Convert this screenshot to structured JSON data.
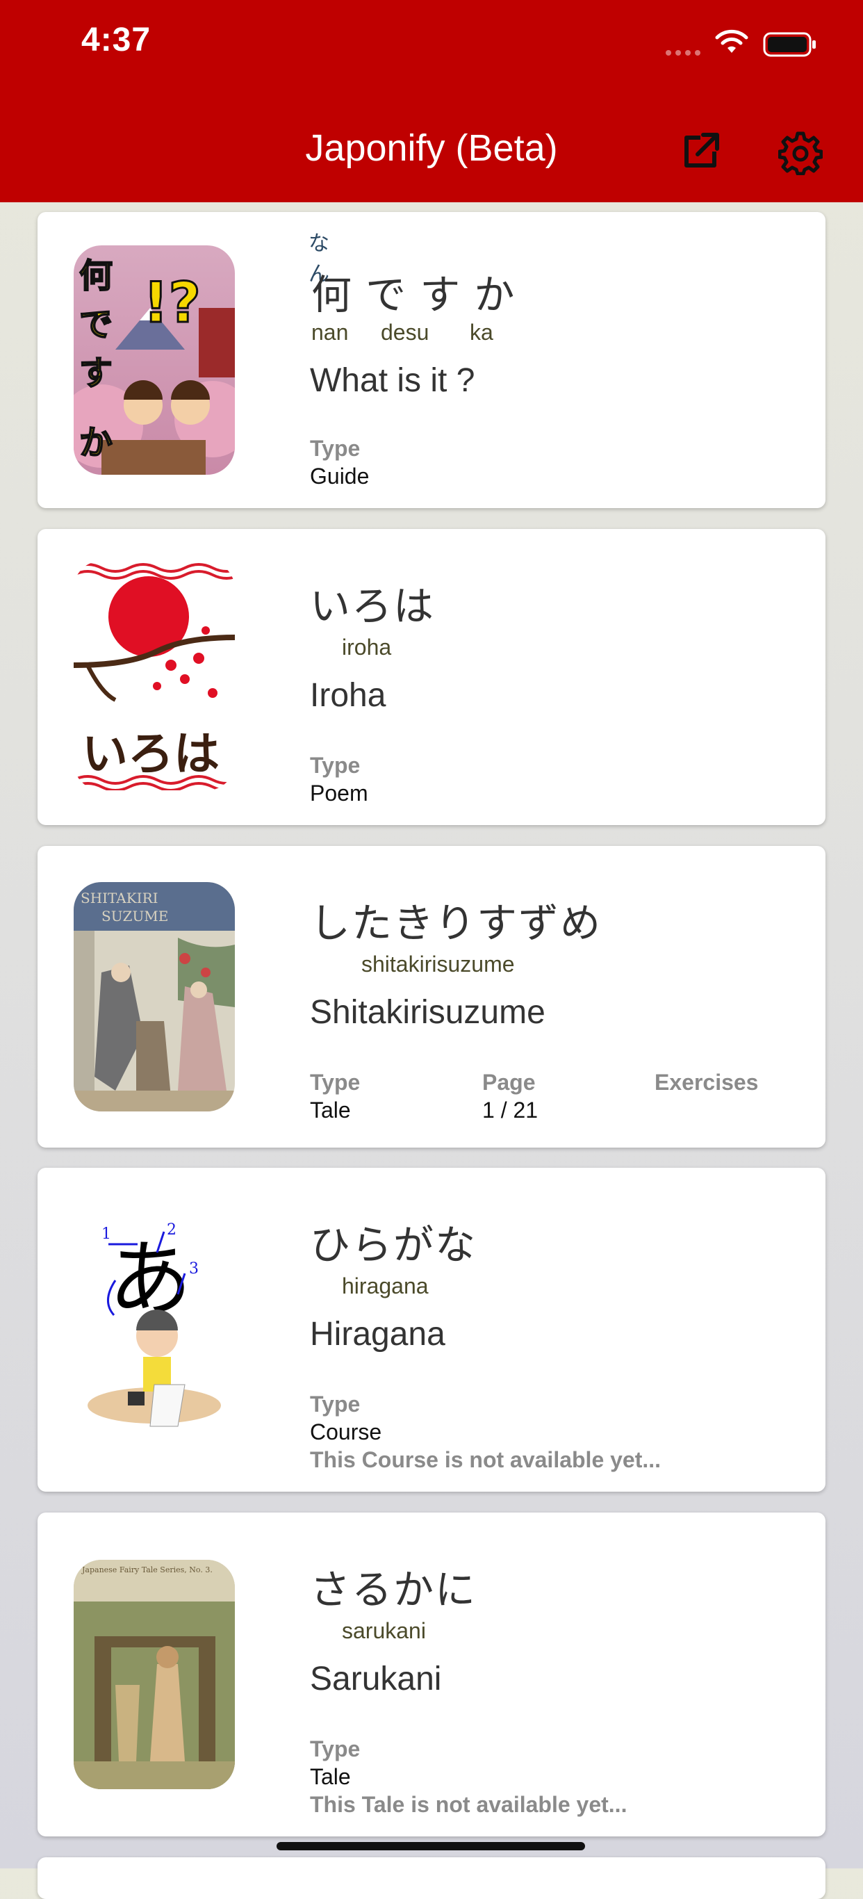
{
  "status_bar": {
    "time": "4:37"
  },
  "header": {
    "title": "Japonify (Beta)"
  },
  "cards": [
    {
      "furigana": "なん",
      "japanese": "何 で す か",
      "romaji": [
        "nan",
        "desu",
        "ka"
      ],
      "english": "What is it ?",
      "type_label": "Type",
      "type_value": "Guide",
      "thumb_text": "何ですか"
    },
    {
      "japanese": "いろは",
      "romaji": "iroha",
      "english": "Iroha",
      "type_label": "Type",
      "type_value": "Poem",
      "thumb_text": "いろは"
    },
    {
      "japanese": "したきりすずめ",
      "romaji": "shitakirisuzume",
      "english": "Shitakirisuzume",
      "type_label": "Type",
      "type_value": "Tale",
      "page_label": "Page",
      "page_value": "1 / 21",
      "exercises_label": "Exercises",
      "thumb_text": "SHITAKIRI SUZUME"
    },
    {
      "japanese": "ひらがな",
      "romaji": "hiragana",
      "english": "Hiragana",
      "type_label": "Type",
      "type_value": "Course",
      "note": "This Course is not available yet...",
      "thumb_text": "あ"
    },
    {
      "japanese": "さるかに",
      "romaji": "sarukani",
      "english": "Sarukani",
      "type_label": "Type",
      "type_value": "Tale",
      "note": "This Tale is not available yet...",
      "thumb_text": "Japanese Fairy Tale Series, No. 3."
    }
  ],
  "icons": {
    "share": "external-link-icon",
    "settings": "gear-icon",
    "wifi": "wifi-icon",
    "battery": "battery-icon"
  },
  "colors": {
    "header": "#bf0000",
    "card": "#ffffff"
  }
}
